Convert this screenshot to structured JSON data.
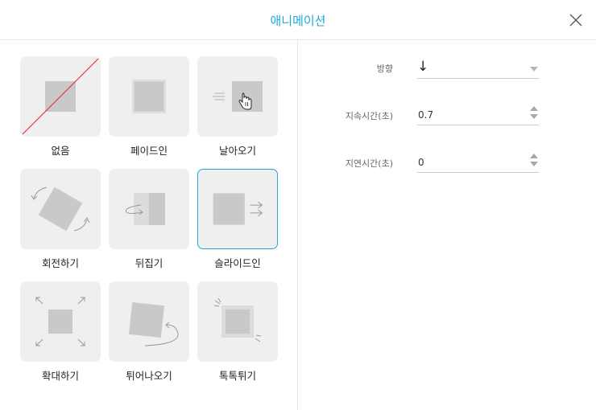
{
  "dialog": {
    "title": "애니메이션",
    "accent_color": "#20a8dc"
  },
  "animations": [
    {
      "label": "없음",
      "icon": "none-icon"
    },
    {
      "label": "페이드인",
      "icon": "fade-in-icon"
    },
    {
      "label": "날아오기",
      "icon": "fly-in-icon"
    },
    {
      "label": "회전하기",
      "icon": "rotate-icon"
    },
    {
      "label": "뒤집기",
      "icon": "flip-icon"
    },
    {
      "label": "슬라이드인",
      "icon": "slide-in-icon",
      "selected": true
    },
    {
      "label": "확대하기",
      "icon": "zoom-icon"
    },
    {
      "label": "튀어나오기",
      "icon": "pop-out-icon"
    },
    {
      "label": "톡톡튀기",
      "icon": "bounce-icon"
    }
  ],
  "settings": {
    "direction": {
      "label": "방향",
      "value": "↓"
    },
    "duration": {
      "label": "지속시간(초)",
      "value": "0.7"
    },
    "delay": {
      "label": "지연시간(초)",
      "value": "0"
    }
  }
}
